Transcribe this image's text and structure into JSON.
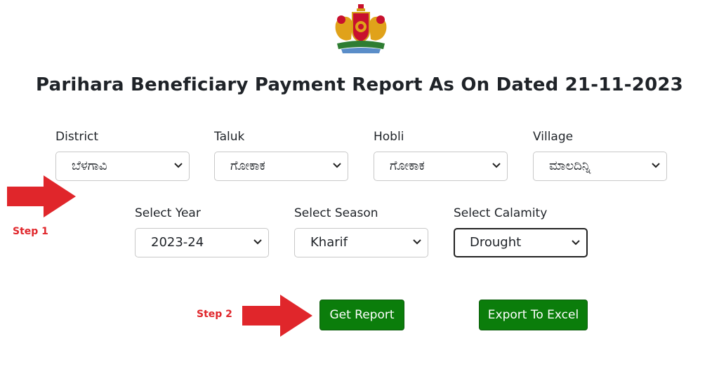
{
  "header": {
    "emblem_icon": "karnataka-emblem-icon",
    "title": "Parihara Beneficiary Payment Report As On Dated 21-11-2023"
  },
  "filters_row1": [
    {
      "label": "District",
      "value": "ಬೆಳಗಾವಿ"
    },
    {
      "label": "Taluk",
      "value": "ಗೋಕಾಕ"
    },
    {
      "label": "Hobli",
      "value": "ಗೋಕಾಕ"
    },
    {
      "label": "Village",
      "value": "ಮಾಲದಿನ್ನಿ"
    }
  ],
  "filters_row2": [
    {
      "label": "Select Year",
      "value": "2023-24"
    },
    {
      "label": "Select Season",
      "value": "Kharif"
    },
    {
      "label": "Select Calamity",
      "value": "Drought"
    }
  ],
  "buttons": {
    "get_report": "Get Report",
    "export_excel": "Export To Excel"
  },
  "annotations": {
    "step1": "Step 1",
    "step2": "Step 2",
    "arrow_color": "#e0262b"
  },
  "colors": {
    "button_green": "#0b7d0b",
    "title_text": "#1f2328"
  }
}
